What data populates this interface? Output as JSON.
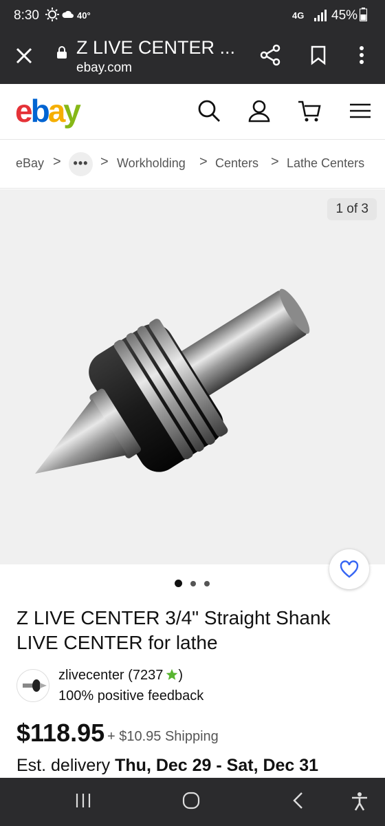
{
  "status_bar": {
    "time": "8:30",
    "temperature": "40°",
    "network": "4G",
    "battery": "45%"
  },
  "browser": {
    "page_title": "Z LIVE CENTER ...",
    "domain": "ebay.com"
  },
  "ebay_header": {
    "logo_letters": [
      "e",
      "b",
      "a",
      "y"
    ],
    "logo_colors": [
      "#e53238",
      "#0064d2",
      "#f5af02",
      "#86b817"
    ]
  },
  "breadcrumb": {
    "items": [
      "eBay",
      "Workholding",
      "Centers",
      "Lathe Centers"
    ],
    "separator": ">",
    "overflow": "•••"
  },
  "gallery": {
    "counter": "1 of 3",
    "image_count": 3,
    "active_index": 0
  },
  "listing": {
    "title": "Z LIVE CENTER 3/4\" Straight Shank  LIVE CENTER  for lathe",
    "seller_name": "zlivecenter",
    "seller_score": "(7237",
    "seller_score_close": ")",
    "feedback": "100% positive feedback",
    "price": "$118.95",
    "shipping": "+ $10.95 Shipping",
    "delivery_label": "Est. delivery",
    "delivery_dates": "Thu, Dec 29 - Sat, Dec 31"
  },
  "colors": {
    "dark_chrome": "#2b2b2d",
    "star_green": "#59b531",
    "heart_blue": "#3665f3"
  }
}
